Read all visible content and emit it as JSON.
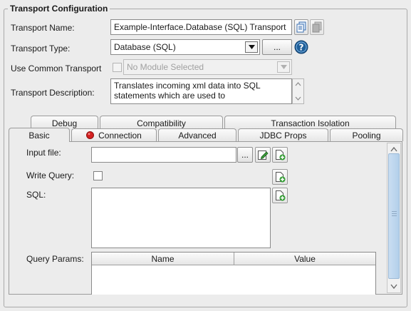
{
  "group": {
    "title": "Transport Configuration"
  },
  "transport_name": {
    "label": "Transport Name:",
    "value": "Example-Interface.Database (SQL) Transport"
  },
  "transport_type": {
    "label": "Transport Type:",
    "value": "Database (SQL)",
    "browse_label": "..."
  },
  "use_common": {
    "label": "Use Common Transport",
    "value": "No Module Selected"
  },
  "description": {
    "label": "Transport Description:",
    "line1": "Translates incoming xml data into SQL",
    "line2": "statements which are used to"
  },
  "tabs": {
    "row1": [
      {
        "label": "Debug"
      },
      {
        "label": "Compatibility"
      },
      {
        "label": "Transaction Isolation"
      }
    ],
    "row2": [
      {
        "label": "Basic"
      },
      {
        "label": "Connection"
      },
      {
        "label": "Advanced"
      },
      {
        "label": "JDBC Props"
      },
      {
        "label": "Pooling"
      }
    ]
  },
  "basic": {
    "input_file_label": "Input file:",
    "input_file_value": "",
    "browse_label": "...",
    "write_query_label": "Write Query:",
    "sql_label": "SQL:",
    "query_params_label": "Query Params:",
    "columns": [
      "Name",
      "Value"
    ]
  },
  "colors": {
    "background": "#ececec",
    "help_blue": "#1f5f99",
    "error_red": "#d42020",
    "new_icon_green": "#2f9a2f",
    "scroll_thumb": "#bcd6ee"
  }
}
